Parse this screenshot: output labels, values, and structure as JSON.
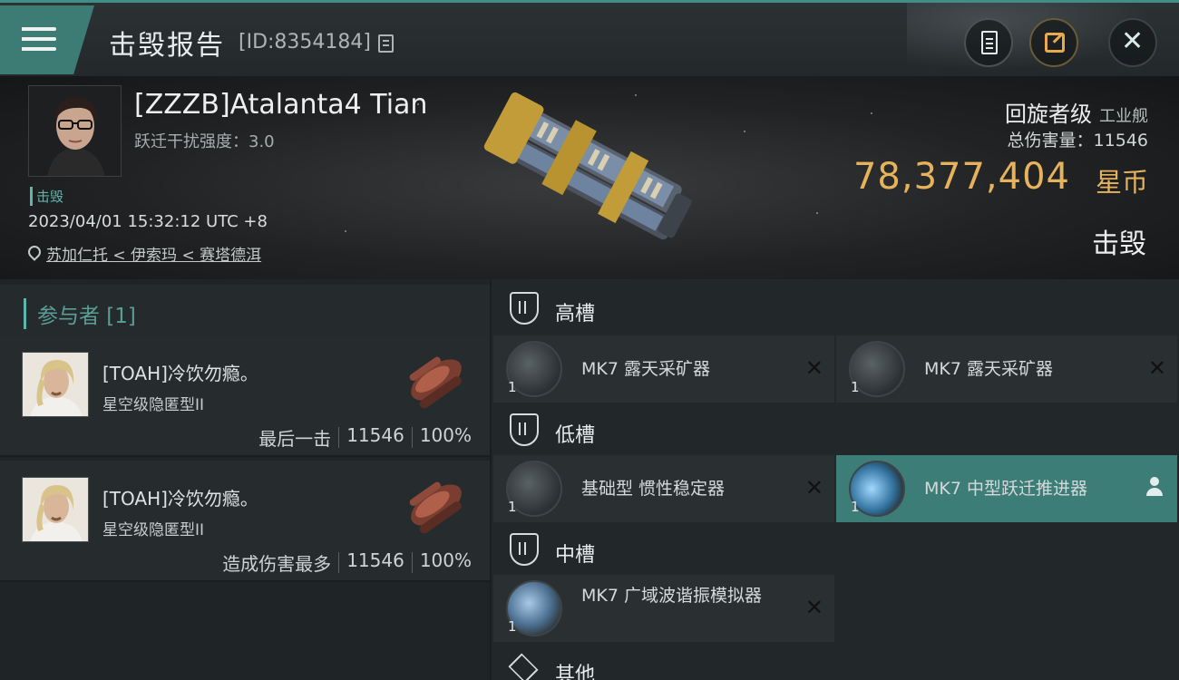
{
  "header": {
    "title": "击毁报告",
    "report_id": "[ID:8354184]"
  },
  "victim": {
    "name": "[ZZZB]Atalanta4 Tian",
    "warp_disruption": "跃迁干扰强度：3.0",
    "tag": "击毁",
    "timestamp": "2023/04/01 15:32:12 UTC +8",
    "location": "苏加仁托 < 伊索玛 < 赛塔德洱",
    "ship_name": "回旋者级",
    "ship_type": "工业舰",
    "total_damage": "总伤害量：11546",
    "isk_value": "78,377,404",
    "isk_unit": "星币",
    "status": "击毁"
  },
  "participants": {
    "header": "参与者 [1]",
    "list": [
      {
        "name": "[TOAH]冷饮勿瘾。",
        "ship": "星空级隐匿型II",
        "role": "最后一击",
        "damage": "11546",
        "percent": "100%"
      },
      {
        "name": "[TOAH]冷饮勿瘾。",
        "ship": "星空级隐匿型II",
        "role": "造成伤害最多",
        "damage": "11546",
        "percent": "100%"
      }
    ]
  },
  "fitting": {
    "high": {
      "title": "高槽",
      "modules": [
        {
          "name": "MK7 露天采矿器",
          "qty": "1",
          "state": "destroyed"
        },
        {
          "name": "MK7 露天采矿器",
          "qty": "1",
          "state": "destroyed"
        }
      ]
    },
    "low": {
      "title": "低槽",
      "modules": [
        {
          "name": "基础型 惯性稳定器",
          "qty": "1",
          "state": "destroyed"
        },
        {
          "name": "MK7 中型跃迁推进器",
          "qty": "1",
          "state": "dropped"
        }
      ]
    },
    "mid": {
      "title": "中槽",
      "modules": [
        {
          "name": "MK7 广域波谐振模拟器",
          "qty": "1",
          "state": "destroyed"
        }
      ]
    },
    "other": {
      "title": "其他"
    }
  },
  "colors": {
    "accent": "#3d7b75",
    "isk_gold": "#e7b25c",
    "highlight": "#3d7d77"
  },
  "icons": {
    "menu": "hamburger-icon",
    "copy": "copy-icon",
    "notes": "clipboard-icon",
    "share": "share-icon",
    "close": "close-icon",
    "location": "pin-icon",
    "slot": "shield-icon",
    "other": "cube-icon",
    "destroyed": "x-icon",
    "dropped": "user-icon"
  }
}
